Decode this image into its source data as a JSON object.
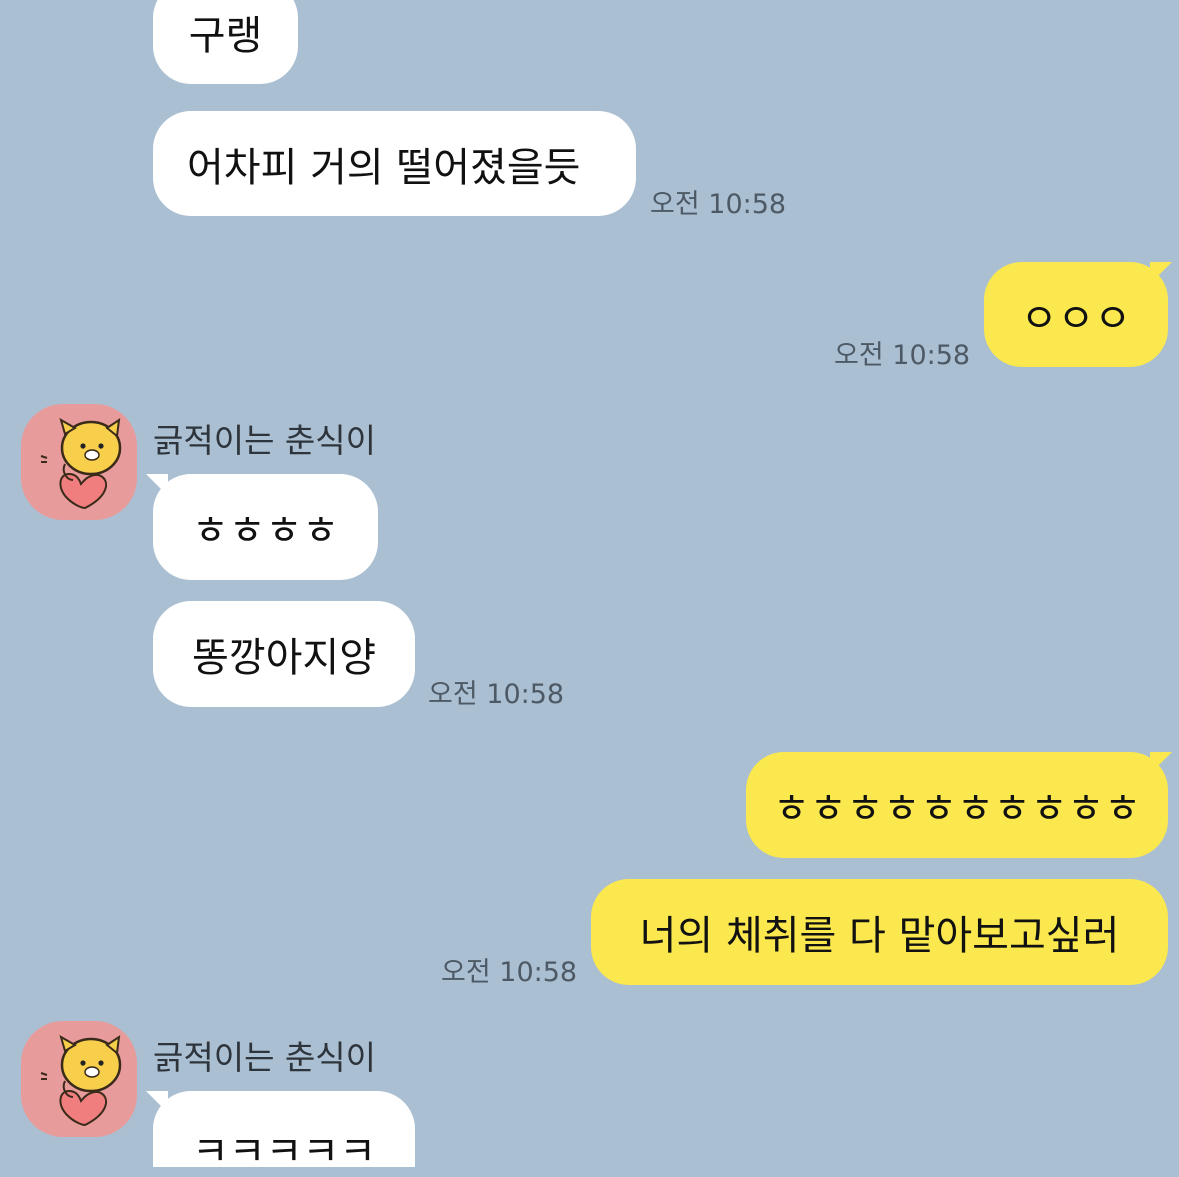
{
  "colors": {
    "background": "#abbfd2",
    "incoming_bubble": "#ffffff",
    "outgoing_bubble": "#fae84e",
    "avatar_background": "#e89b9b",
    "timestamp": "#4d5a66"
  },
  "messages": [
    {
      "direction": "incoming",
      "text": "구랭",
      "time": ""
    },
    {
      "direction": "incoming",
      "text": "어차피 거의 떨어졌을듯",
      "time": "오전 10:58"
    },
    {
      "direction": "outgoing",
      "text": "ㅇㅇㅇ",
      "time": "오전 10:58"
    },
    {
      "direction": "incoming",
      "sender": "긁적이는 춘식이",
      "avatar": "chunsik-character-icon",
      "text": "ㅎㅎㅎㅎ",
      "time": ""
    },
    {
      "direction": "incoming",
      "text": "똥깡아지양",
      "time": "오전 10:58"
    },
    {
      "direction": "outgoing",
      "text": "ㅎㅎㅎㅎㅎㅎㅎㅎㅎㅎ",
      "time": ""
    },
    {
      "direction": "outgoing",
      "text": "너의 체취를 다 맡아보고싶러",
      "time": "오전 10:58"
    },
    {
      "direction": "incoming",
      "sender": "긁적이는 춘식이",
      "avatar": "chunsik-character-icon",
      "text": "ㅋㅋㅋㅋㅋ",
      "time": ""
    }
  ]
}
